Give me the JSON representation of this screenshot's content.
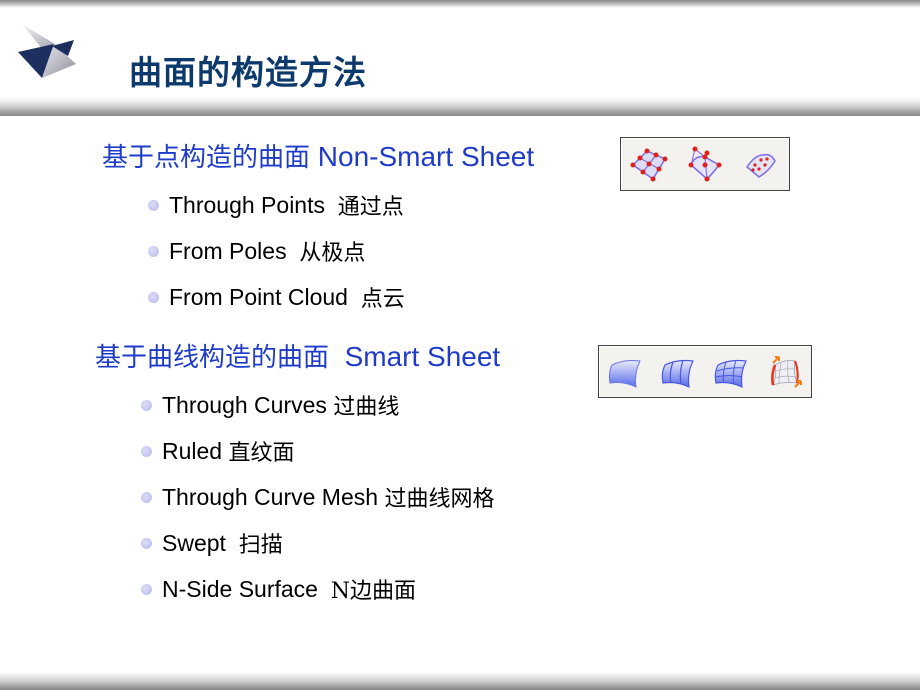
{
  "slide": {
    "title": "曲面的构造方法",
    "logo": "pyramid-logo-icon"
  },
  "sections": [
    {
      "heading_cn": "基于点构造的曲面",
      "heading_en": "Non-Smart Sheet",
      "toolbar_icons": [
        "through-points-surface-icon",
        "from-poles-surface-icon",
        "from-point-cloud-surface-icon"
      ],
      "items": [
        {
          "en": "Through Points",
          "cn": "通过点"
        },
        {
          "en": "From Poles",
          "cn": "从极点"
        },
        {
          "en": "From Point Cloud",
          "cn": "点云"
        }
      ]
    },
    {
      "heading_cn": "基于曲线构造的曲面",
      "heading_en": "Smart Sheet",
      "toolbar_icons": [
        "ruled-surface-icon",
        "through-curves-surface-icon",
        "through-curve-mesh-surface-icon",
        "n-side-surface-icon"
      ],
      "items": [
        {
          "en": "Through Curves",
          "cn": "过曲线"
        },
        {
          "en": "Ruled",
          "cn": "直纹面"
        },
        {
          "en": "Through Curve Mesh",
          "cn": "过曲线网格"
        },
        {
          "en": "Swept",
          "cn": "扫描"
        },
        {
          "en": "N-Side Surface",
          "cn": "N边曲面"
        }
      ]
    }
  ],
  "colors": {
    "title": "#0c3a6c",
    "heading": "#1f3cc8",
    "bullet": "#c0c0ee"
  }
}
